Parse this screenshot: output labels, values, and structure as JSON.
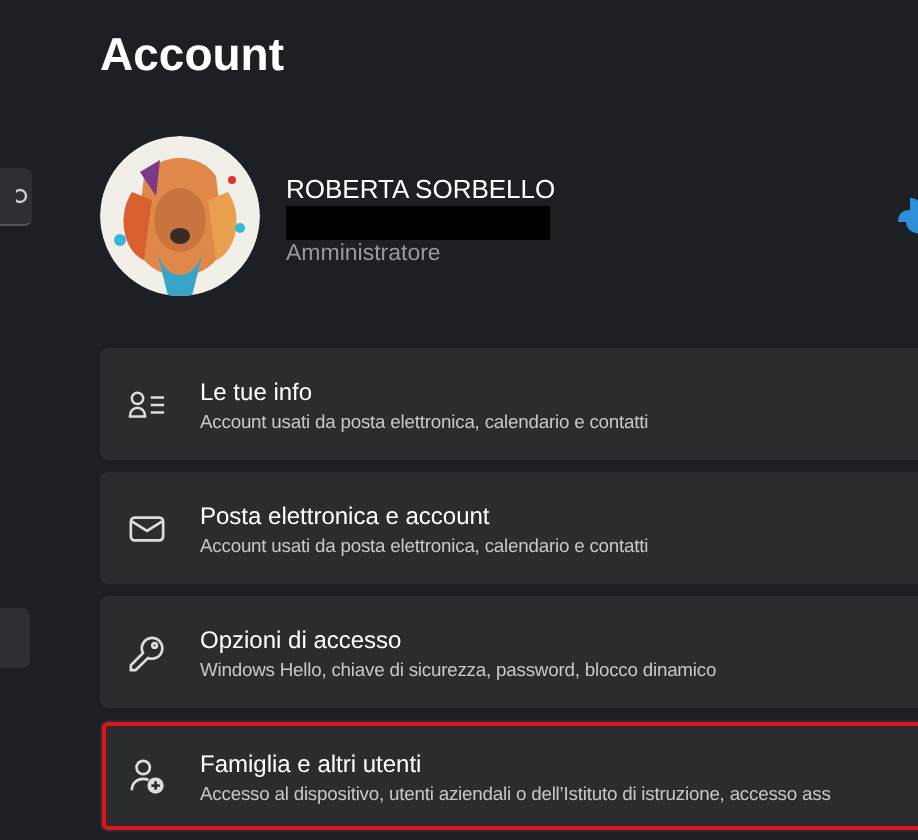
{
  "page_title": "Account",
  "profile": {
    "name": "ROBERTA SORBELLO",
    "redacted": true,
    "role": "Amministratore"
  },
  "sidebar": {
    "items": [
      {
        "selected": true
      }
    ]
  },
  "cards": [
    {
      "kind": "person-list",
      "title": "Le tue info",
      "description": "Account usati da posta elettronica, calendario e contatti",
      "highlighted": false
    },
    {
      "kind": "mail",
      "title": "Posta elettronica e account",
      "description": "Account usati da posta elettronica, calendario e contatti",
      "highlighted": false
    },
    {
      "kind": "key",
      "title": "Opzioni di accesso",
      "description": "Windows Hello, chiave di sicurezza, password, blocco dinamico",
      "highlighted": false
    },
    {
      "kind": "person-add",
      "title": "Famiglia e altri utenti",
      "description": "Accesso al dispositivo, utenti aziendali o dell’Istituto di istruzione, accesso ass",
      "highlighted": true
    }
  ]
}
